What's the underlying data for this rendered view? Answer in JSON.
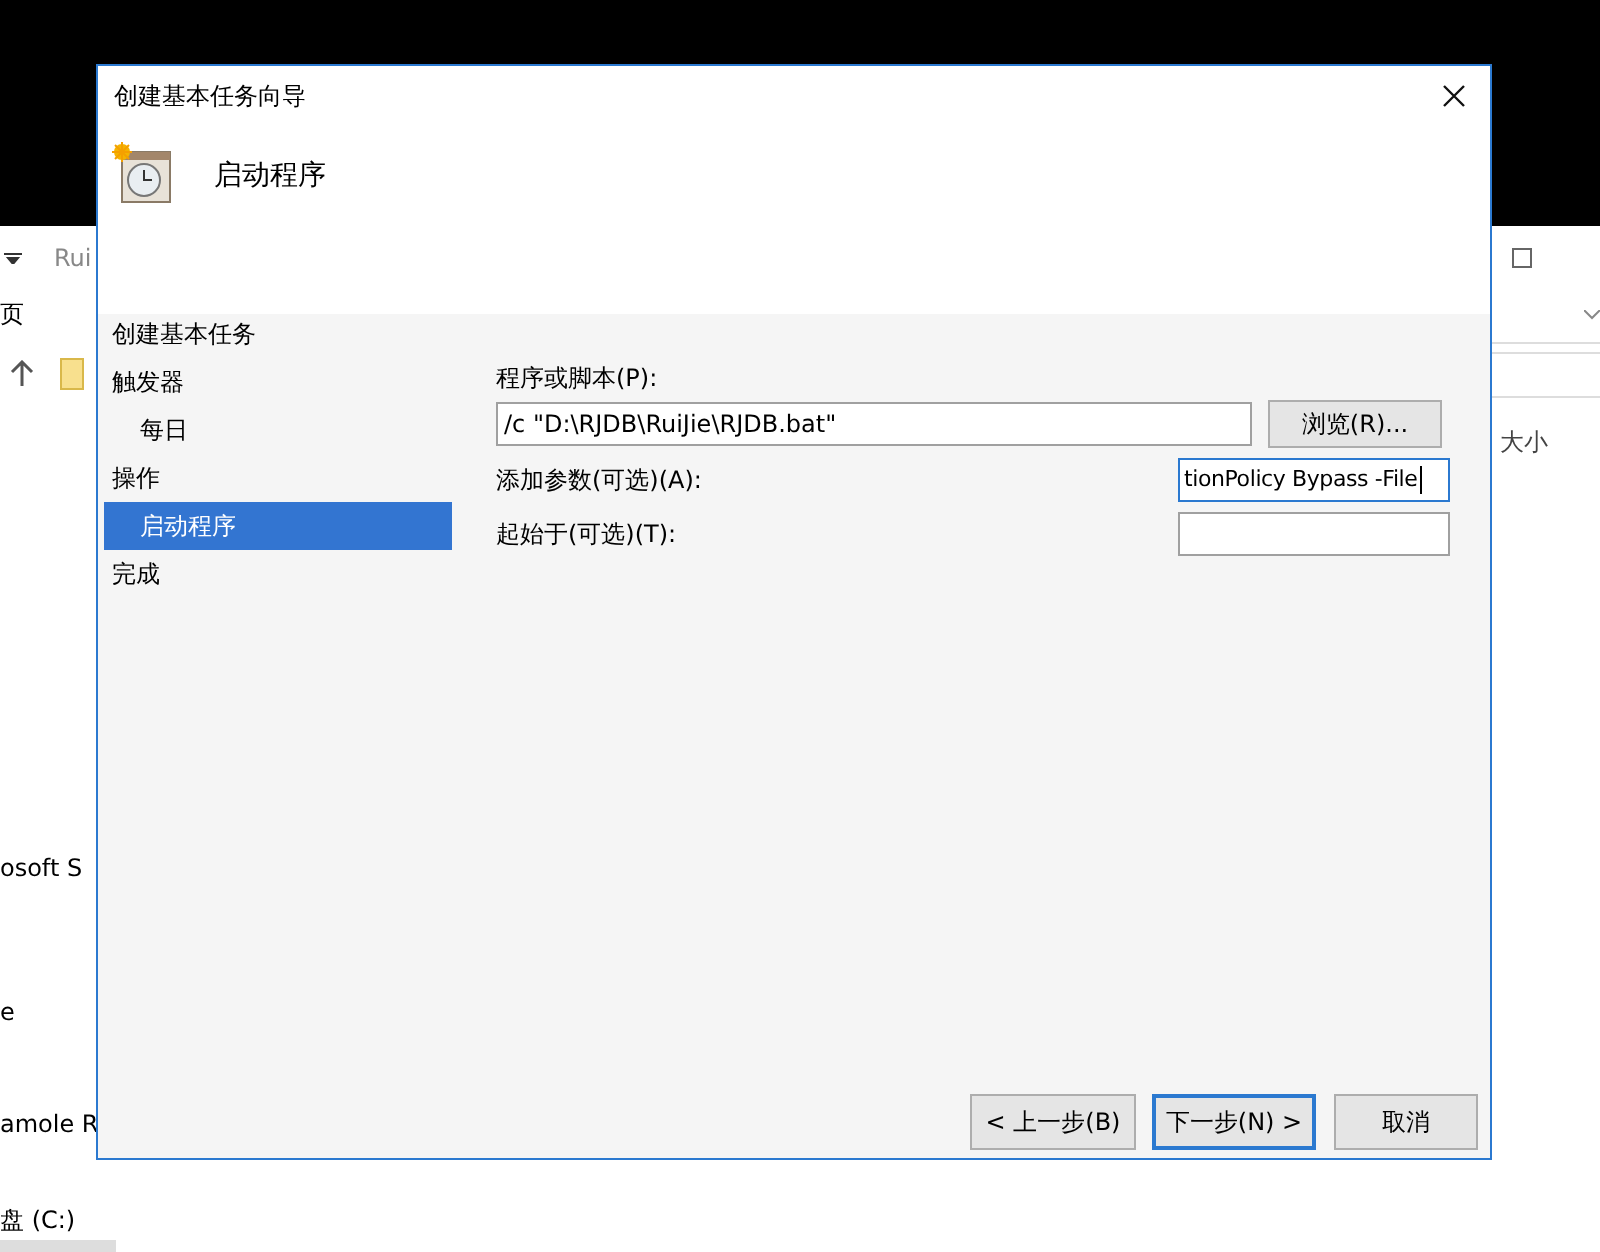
{
  "background_window": {
    "address_crumb": "Rui",
    "ribbon_tab": "页",
    "nav_items": [
      "osoft S",
      "e",
      "amole R",
      "盘 (C:)"
    ],
    "column_header": "大小"
  },
  "dialog": {
    "title": "创建基本任务向导",
    "heading": "启动程序",
    "section_title": "创建基本任务",
    "steps": [
      {
        "label": "触发器",
        "selected": false,
        "children": [
          {
            "label": "每日",
            "selected": false
          }
        ]
      },
      {
        "label": "操作",
        "selected": false,
        "children": [
          {
            "label": "启动程序",
            "selected": true
          }
        ]
      },
      {
        "label": "完成",
        "selected": false
      }
    ],
    "program": {
      "label": "程序或脚本(P):",
      "value": "/c \"D:\\RJDB\\RuiJie\\RJDB.bat\"",
      "browse": "浏览(R)..."
    },
    "arguments": {
      "label": "添加参数(可选)(A):",
      "value": "tionPolicy Bypass -File",
      "focused": true
    },
    "start_in": {
      "label": "起始于(可选)(T):",
      "focused": false
    },
    "buttons": [
      {
        "label": "< 上一步(B)",
        "default": false
      },
      {
        "label": "下一步(N) >",
        "default": true
      },
      {
        "label": "取消",
        "default": false
      }
    ]
  }
}
